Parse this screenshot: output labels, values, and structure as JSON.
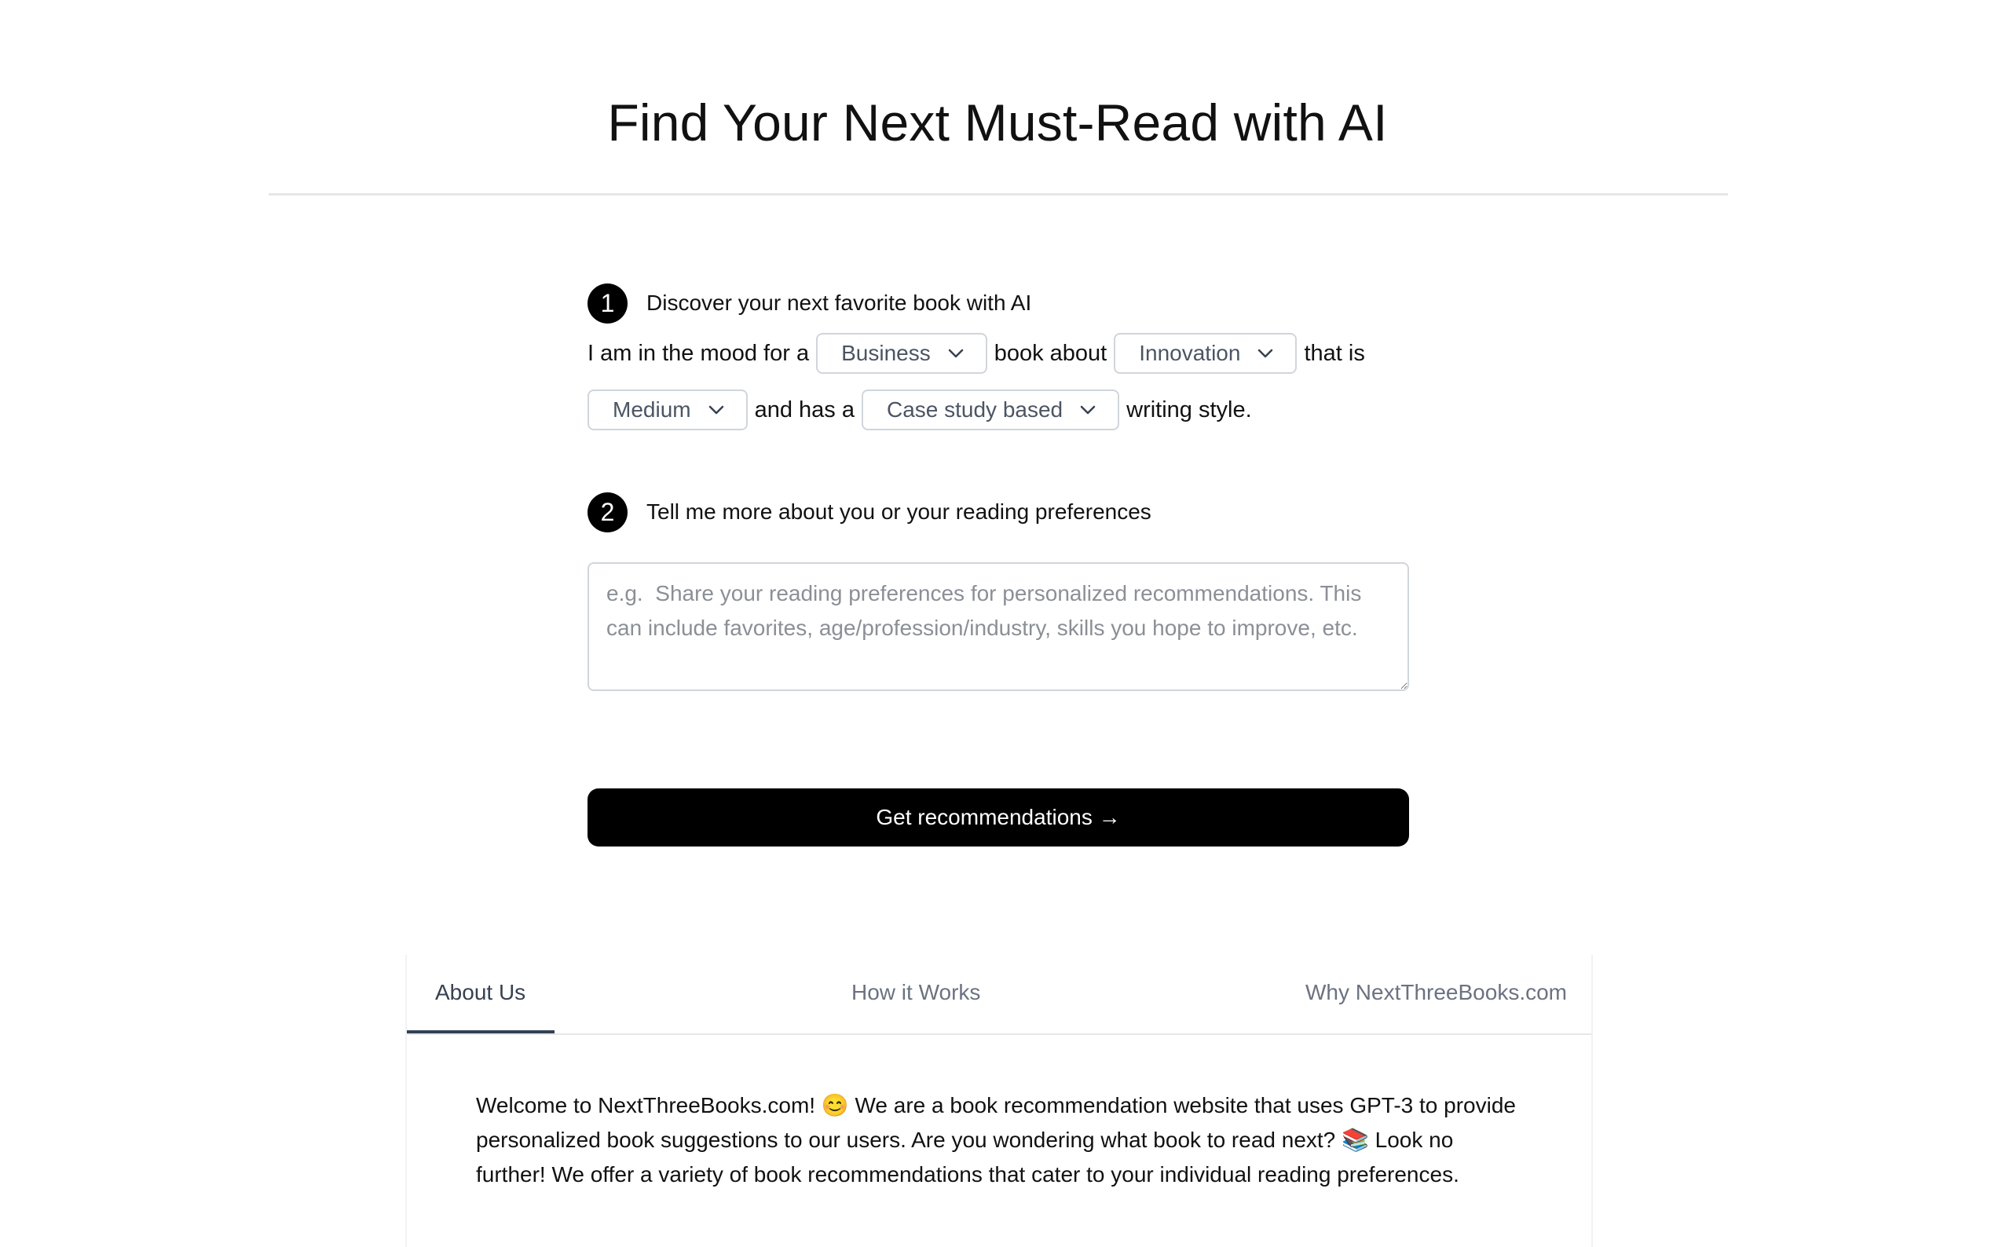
{
  "header": {
    "title": "Find Your Next Must-Read with AI"
  },
  "step1": {
    "number": "1",
    "label": "Discover your next favorite book with AI",
    "sentence": {
      "prefix": "I am in the mood for a",
      "genre": "Business",
      "after_genre": "book about",
      "topic": "Innovation",
      "after_topic": "that is",
      "length": "Medium",
      "after_length": "and has a",
      "style": "Case study based",
      "suffix": "writing style."
    }
  },
  "step2": {
    "number": "2",
    "label": "Tell me more about you or your reading preferences",
    "textarea": {
      "value": "",
      "placeholder": "e.g.  Share your reading preferences for personalized recommendations. This can include favorites, age/profession/industry, skills you hope to improve, etc."
    }
  },
  "cta": {
    "label": "Get recommendations →"
  },
  "tabs": {
    "items": [
      {
        "label": "About Us",
        "active": true
      },
      {
        "label": "How it Works",
        "active": false
      },
      {
        "label": "Why NextThreeBooks.com",
        "active": false
      }
    ],
    "about_text": "Welcome to NextThreeBooks.com! 😊 We are a book recommendation website that uses GPT-3 to provide personalized book suggestions to our users. Are you wondering what book to read next? 📚 Look no further! We offer a variety of book recommendations that cater to your individual reading preferences."
  },
  "icons": {
    "dropdown": "chevron-down-icon"
  },
  "colors": {
    "accent": "#000000",
    "active_tab_indicator": "#334155",
    "border": "#d1d5db"
  }
}
